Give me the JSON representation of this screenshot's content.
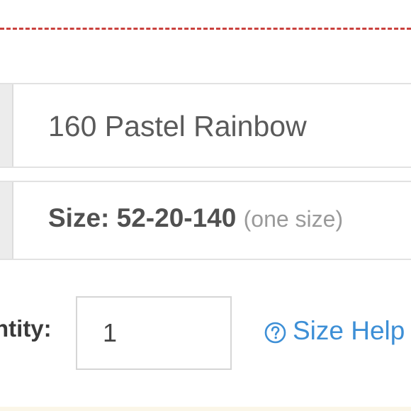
{
  "color_option": {
    "value": "160 Pastel Rainbow"
  },
  "size_option": {
    "value": "Size: 52-20-140",
    "note": "(one size)"
  },
  "quantity": {
    "label": "ntity:",
    "value": "1"
  },
  "size_help": {
    "label": "Size Help",
    "icon": "question-circle-icon"
  },
  "colors": {
    "divider": "#c9413e",
    "link": "#3d8fd6",
    "border": "#e2e2e2"
  }
}
